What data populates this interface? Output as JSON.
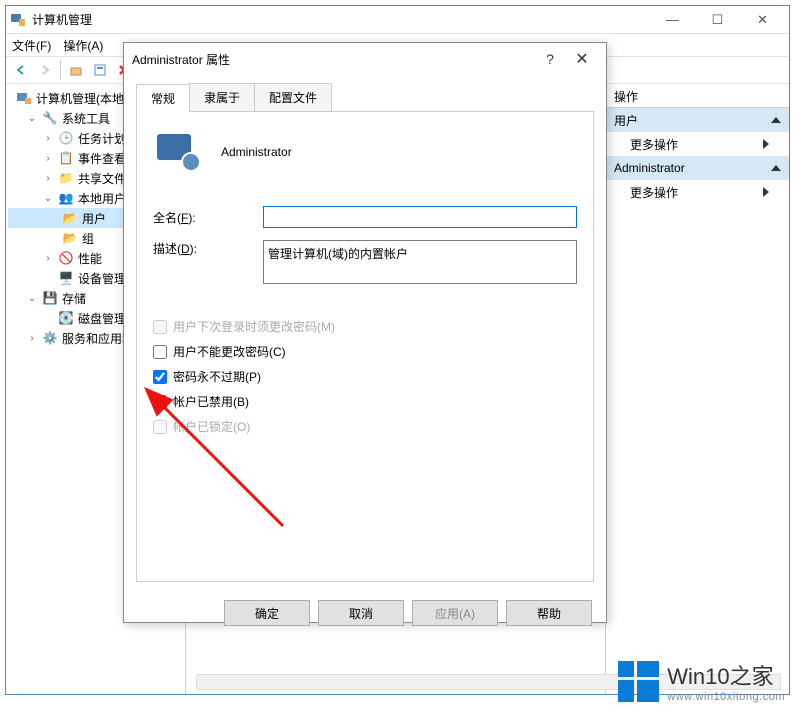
{
  "window": {
    "title": "计算机管理",
    "menu": {
      "file": "文件(F)",
      "action": "操作(A)"
    }
  },
  "tree": {
    "root": "计算机管理(本地)",
    "systools": "系统工具",
    "tasks": "任务计划程",
    "events": "事件查看器",
    "sharedfolders": "共享文件夹",
    "localusers": "本地用户和组",
    "users": "用户",
    "groups": "组",
    "perf": "性能",
    "devmgr": "设备管理器",
    "storage": "存储",
    "diskmgmt": "磁盘管理",
    "services": "服务和应用程"
  },
  "actions": {
    "header": "操作",
    "group1": "用户",
    "more1": "更多操作",
    "group2": "Administrator",
    "more2": "更多操作"
  },
  "dialog": {
    "title": "Administrator 属性",
    "tabs": {
      "general": "常规",
      "memberof": "隶属于",
      "profile": "配置文件"
    },
    "username": "Administrator",
    "fullname_label": "全名(F):",
    "fullname_value": "",
    "desc_label": "描述(D):",
    "desc_value": "管理计算机(域)的内置帐户",
    "chk_mustchange": "用户下次登录时须更改密码(M)",
    "chk_cannotchange": "用户不能更改密码(C)",
    "chk_neverexpire": "密码永不过期(P)",
    "chk_disabled": "帐户已禁用(B)",
    "chk_locked": "帐户已锁定(O)",
    "btn_ok": "确定",
    "btn_cancel": "取消",
    "btn_apply": "应用(A)",
    "btn_help": "帮助"
  },
  "watermark": {
    "brand": "Win10之家",
    "url": "www.win10xitong.com"
  }
}
